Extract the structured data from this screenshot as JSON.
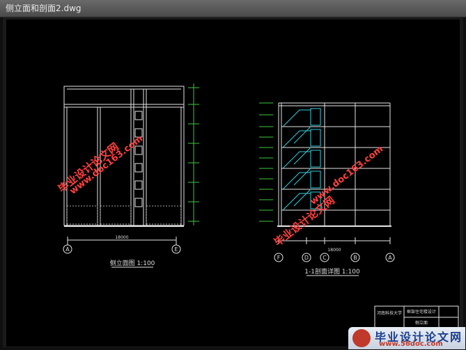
{
  "window": {
    "title": "侧立面和剖面2.dwg"
  },
  "drawing_left": {
    "caption": "侧立面图 1:100",
    "axis_labels": [
      "A",
      "E"
    ],
    "dim_text": "18000"
  },
  "drawing_right": {
    "caption": "1-1剖面详图 1:100",
    "axis_labels": [
      "F",
      "D",
      "C",
      "B",
      "A"
    ],
    "dim_text": "18000"
  },
  "watermarks": {
    "url": "www.doc163.com",
    "site_name": "毕业设计论文网"
  },
  "title_block": {
    "school": "河南科技大学",
    "project": "框架住宅楼设计",
    "sheet": "侧立面"
  },
  "footer_logo": {
    "name": "毕业设计论文网",
    "url": "www.56doc.com"
  },
  "colors": {
    "background": "#000000",
    "lines": "#e6e6e6",
    "accent_cyan": "#35d0e0",
    "accent_green": "#3ec83e",
    "watermark": "#ff4040"
  }
}
